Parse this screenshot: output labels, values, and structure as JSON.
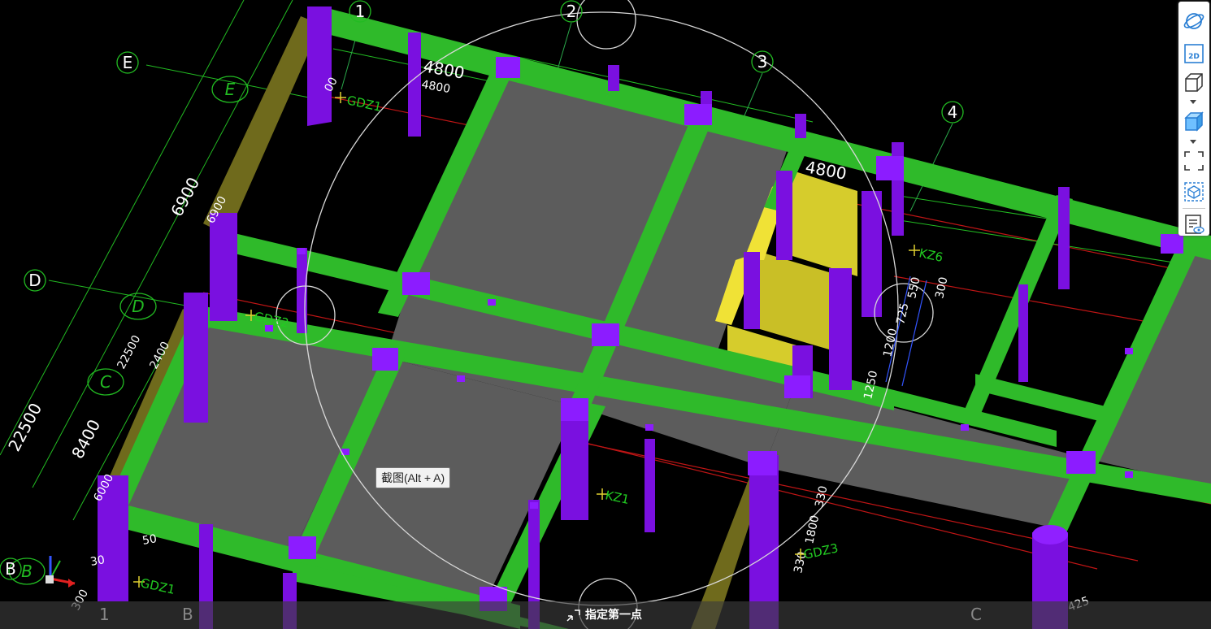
{
  "axes": {
    "numbered": [
      "1",
      "2",
      "3",
      "4"
    ],
    "lettered": [
      "E",
      "D",
      "B"
    ],
    "lettered_italic": [
      "E",
      "D",
      "C",
      "B"
    ],
    "bottom": [
      "1",
      "B",
      "C"
    ]
  },
  "dimensions": {
    "top_span_1": "4800",
    "top_span_1b": "4800",
    "top_span_2": "4800",
    "left_span_1": "6900",
    "left_span_1b": "6900",
    "left_total": "22500",
    "left_total_b": "22500",
    "left_span_2": "8400",
    "left_sub_2400": "2400",
    "left_sub_6000": "6000",
    "right_300": "300",
    "right_725": "725",
    "right_550": "550",
    "right_1200": "1200",
    "right_1250": "1250",
    "right_1800": "1800",
    "right_330": "330",
    "right_330b": "330",
    "right_425": "425",
    "small_50": "50",
    "small_30": "30",
    "small_300": "300"
  },
  "element_labels": {
    "gdz1_top": "GDZ1",
    "gdz2": "GDZ2",
    "kz6": "KZ6",
    "kz1": "KZ1",
    "gdz3": "GDZ3",
    "gdz1_bottom": "GDZ1",
    "prefix_00": "00"
  },
  "toolbar": {
    "orbit_icon": "orbit-icon",
    "view_2d_label": "2D",
    "items": [
      "orbit",
      "2d-view",
      "3d-view-wireframe",
      "3d-view-solid",
      "zoom-extents",
      "selection-box",
      "view-properties"
    ]
  },
  "tooltip": {
    "text": "截图(Alt + A)"
  },
  "status": {
    "prompt": "指定第一点"
  },
  "colors": {
    "beam": "#2fba2a",
    "column": "#7a10e0",
    "slab": "#5c5c5c",
    "wall": "#d6cc2c",
    "dim_line": "#22cc22",
    "grid_line": "#d81818",
    "background": "#000000"
  }
}
